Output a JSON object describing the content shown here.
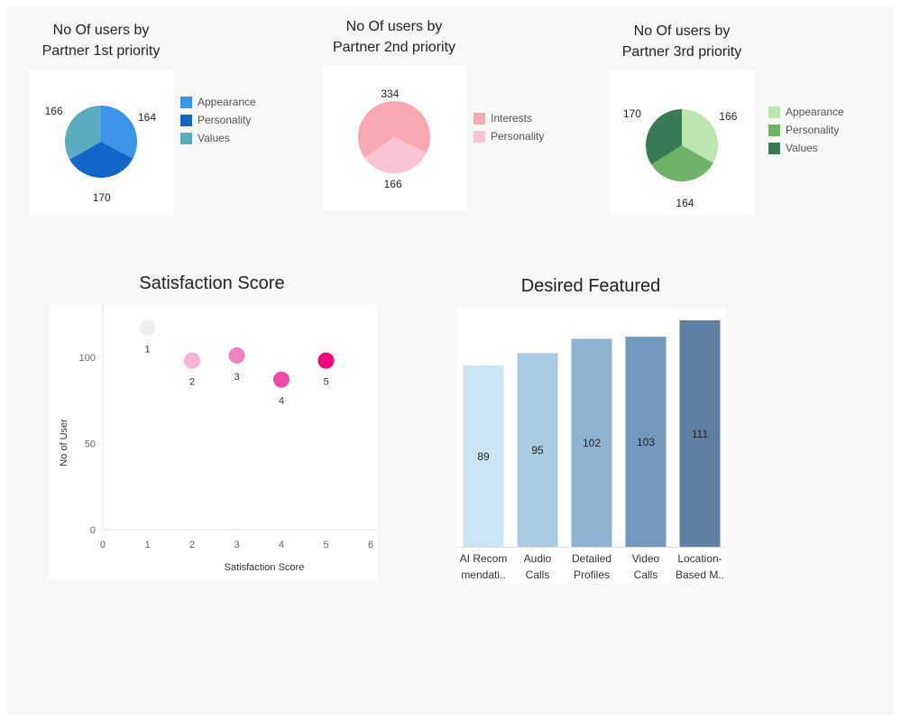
{
  "charts": {
    "pie1": {
      "title_line1": "No Of users by",
      "title_line2": "Partner 1st priority",
      "legend": [
        {
          "label": "Appearance",
          "color": "#3b94e8"
        },
        {
          "label": "Personality",
          "color": "#1565c8"
        },
        {
          "label": "Values",
          "color": "#5aabbf"
        }
      ]
    },
    "pie2": {
      "title_line1": "No Of users by",
      "title_line2": "Partner 2nd priority",
      "legend": [
        {
          "label": "Interests",
          "color": "#f7a8b0"
        },
        {
          "label": "Personality",
          "color": "#fac4d4"
        }
      ]
    },
    "pie3": {
      "title_line1": "No Of users by",
      "title_line2": "Partner 3rd priority",
      "legend": [
        {
          "label": "Appearance",
          "color": "#bde5b0"
        },
        {
          "label": "Personality",
          "color": "#6fb369"
        },
        {
          "label": "Values",
          "color": "#3a7a52"
        }
      ]
    },
    "scatter": {
      "title": "Satisfaction Score"
    },
    "bars": {
      "title": "Desired Featured"
    }
  },
  "chart_data": [
    {
      "type": "pie",
      "title": "No Of users by Partner 1st priority",
      "categories": [
        "Appearance",
        "Personality",
        "Values"
      ],
      "values": [
        164,
        170,
        166
      ],
      "colors": [
        "#3b94e8",
        "#1565c8",
        "#5aabbf"
      ]
    },
    {
      "type": "pie",
      "title": "No Of users by Partner 2nd priority",
      "categories": [
        "Interests",
        "Personality"
      ],
      "values": [
        334,
        166
      ],
      "colors": [
        "#f7a8b0",
        "#fac4d4"
      ]
    },
    {
      "type": "pie",
      "title": "No Of users by Partner 3rd priority",
      "categories": [
        "Appearance",
        "Personality",
        "Values"
      ],
      "values": [
        166,
        164,
        170
      ],
      "colors": [
        "#bde5b0",
        "#6fb369",
        "#3a7a52"
      ]
    },
    {
      "type": "scatter",
      "title": "Satisfaction Score",
      "xlabel": "Satisfaction Score",
      "ylabel": "No of User",
      "xlim": [
        0,
        6
      ],
      "ylim": [
        0,
        125
      ],
      "x_ticks": [
        0,
        1,
        2,
        3,
        4,
        5,
        6
      ],
      "y_ticks": [
        0,
        50,
        100
      ],
      "points": [
        {
          "x": 1,
          "y": 117,
          "label": "1",
          "color": "#eeeeee"
        },
        {
          "x": 2,
          "y": 98,
          "label": "2",
          "color": "#f5b3d6"
        },
        {
          "x": 3,
          "y": 101,
          "label": "3",
          "color": "#f080c0"
        },
        {
          "x": 4,
          "y": 87,
          "label": "4",
          "color": "#ec4aa6"
        },
        {
          "x": 5,
          "y": 98,
          "label": "5",
          "color": "#f0067e"
        }
      ]
    },
    {
      "type": "bar",
      "title": "Desired Featured",
      "categories": [
        [
          "AI Recom",
          "mendati.."
        ],
        [
          "Audio",
          "Calls"
        ],
        [
          "Detailed",
          "Profiles"
        ],
        [
          "Video",
          "Calls"
        ],
        [
          "Location-",
          "Based M.."
        ]
      ],
      "values": [
        89,
        95,
        102,
        103,
        111
      ],
      "colors": [
        "#cce5f5",
        "#a9cce3",
        "#8db2d2",
        "#7399bf",
        "#5e80a5"
      ]
    }
  ]
}
